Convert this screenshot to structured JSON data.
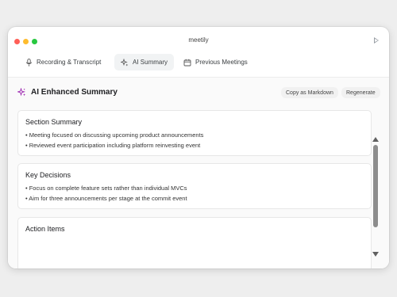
{
  "window": {
    "title": "meetily"
  },
  "tabs": [
    {
      "label": "Recording & Transcript",
      "icon": "microphone-icon",
      "active": false
    },
    {
      "label": "AI Summary",
      "icon": "sparkles-icon",
      "active": true
    },
    {
      "label": "Previous Meetings",
      "icon": "calendar-icon",
      "active": false
    }
  ],
  "summary": {
    "title": "AI Enhanced Summary",
    "title_icon": "sparkles-icon",
    "accent_color": "#9c27b0",
    "copy_label": "Copy as Markdown",
    "regenerate_label": "Regenerate"
  },
  "sections": [
    {
      "title": "Section Summary",
      "bullets": [
        "• Meeting focused on discussing upcoming product announcements",
        "• Reviewed event participation including platform reinvesting event"
      ]
    },
    {
      "title": "Key Decisions",
      "bullets": [
        "• Focus on complete feature sets rather than individual MVCs",
        "• Aim for three announcements per stage at the commit event"
      ]
    },
    {
      "title": "Action Items",
      "bullets": []
    }
  ]
}
